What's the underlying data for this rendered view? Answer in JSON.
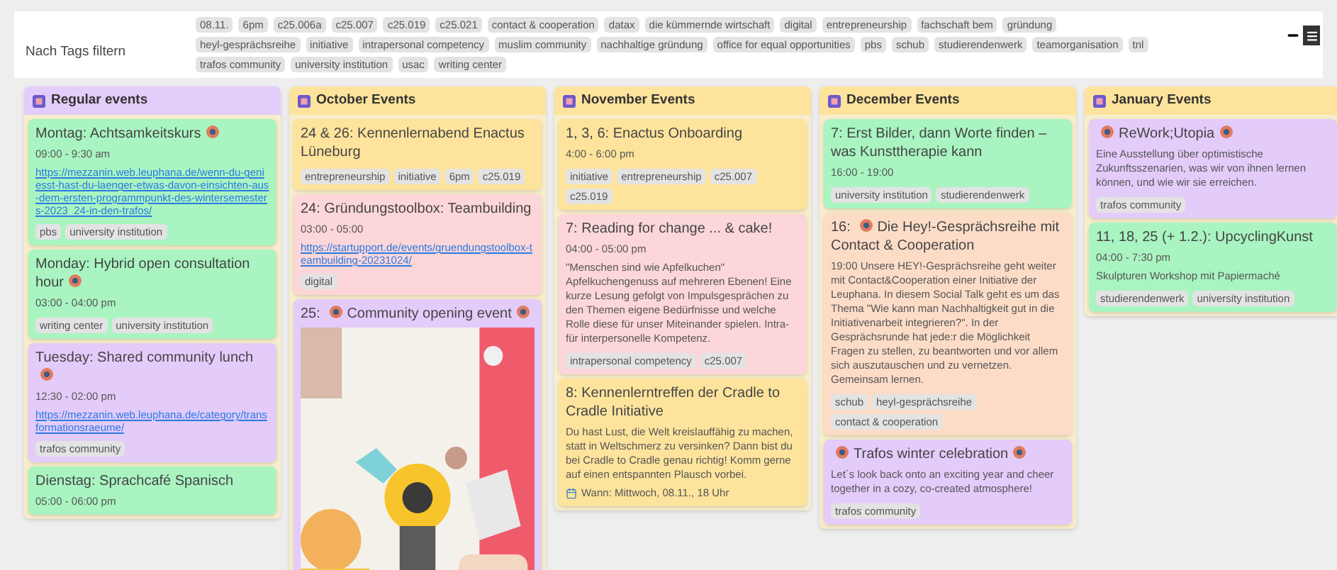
{
  "filter": {
    "label": "Nach Tags filtern",
    "tags": [
      "08.11.",
      "6pm",
      "c25.006a",
      "c25.007",
      "c25.019",
      "c25.021",
      "contact & cooperation",
      "datax",
      "die kümmernde wirtschaft",
      "digital",
      "entrepreneurship",
      "fachschaft bem",
      "gründung",
      "heyl-gesprächsreihe",
      "initiative",
      "intrapersonal competency",
      "muslim community",
      "nachhaltige gründung",
      "office for equal opportunities",
      "pbs",
      "schub",
      "studierendenwerk",
      "teamorganisation",
      "tnl",
      "trafos community",
      "university institution",
      "usac",
      "writing center"
    ]
  },
  "columns": [
    {
      "title": "Regular events",
      "color": "#e3cdfb",
      "cards": [
        {
          "title": "Montag: Achtsamkeitskurs",
          "icon_after": true,
          "color": "#a9f4c1",
          "time": "09:00 - 9:30 am",
          "link": "https://mezzanin.web.leuphana.de/wenn-du-geniesst-hast-du-laenger-etwas-davon-einsichten-aus-dem-ersten-programmpunkt-des-wintersemesters-2023_24-in-den-trafos/",
          "tags": [
            "pbs",
            "university institution"
          ]
        },
        {
          "title": "Monday: Hybrid open consultation hour",
          "icon_after": true,
          "color": "#a9f4c1",
          "time": "03:00 - 04:00 pm",
          "tags": [
            "writing center",
            "university institution"
          ]
        },
        {
          "title": "Tuesday: Shared community lunch",
          "icon_after": true,
          "color": "#e3cbfa",
          "time": "12:30 - 02:00 pm",
          "link": "https://mezzanin.web.leuphana.de/category/transformationsraeume/",
          "tags": [
            "trafos community"
          ]
        },
        {
          "title": "Dienstag: Sprachcafé Spanisch",
          "color": "#a9f4c1",
          "time": "05:00 - 06:00 pm"
        }
      ]
    },
    {
      "title": "October Events",
      "color": "#fde39c",
      "cards": [
        {
          "title": "24 & 26: Kennenlernabend Enactus Lüneburg",
          "color": "#fde39c",
          "tags": [
            "entrepreneurship",
            "initiative",
            "6pm",
            "c25.019"
          ]
        },
        {
          "title": "24: Gründungstoolbox: Teambuilding",
          "color": "#fdd6d9",
          "time": "03:00 - 05:00",
          "link": "https://startupport.de/events/gruendungstoolbox-teambuilding-20231024/",
          "tags": [
            "digital"
          ]
        },
        {
          "prefix": "25:",
          "title": "Community opening event",
          "icon_before": true,
          "icon_after": true,
          "color": "#e3cbfa",
          "picture": true
        }
      ]
    },
    {
      "title": "November Events",
      "color": "#fde39c",
      "cards": [
        {
          "title": "1, 3, 6: Enactus Onboarding",
          "color": "#fde39c",
          "time": "4:00 - 6:00 pm",
          "tags": [
            "initiative",
            "entrepreneurship",
            "c25.007",
            "c25.019"
          ]
        },
        {
          "title": "7: Reading for change ... & cake!",
          "color": "#fdd6d9",
          "time": "04:00 - 05:00 pm",
          "description": "\"Menschen sind wie Apfelkuchen\" Apfelkuchengenuss auf mehreren Ebenen! Eine kurze Lesung gefolgt von Impulsgesprächen zu den Themen eigene Bedürfnisse und welche Rolle diese für unser Miteinander spielen. Intra- für interpersonelle Kompetenz.",
          "tags": [
            "intrapersonal competency",
            "c25.007"
          ]
        },
        {
          "title": "8: Kennenlerntreffen der Cradle to Cradle Initiative",
          "color": "#fde39c",
          "description": "Du hast Lust, die Welt kreislauffähig zu machen, statt in Weltschmerz zu versinken? Dann bist du bei Cradle to Cradle genau richtig! Komm gerne auf einen entspannten Plausch vorbei.",
          "footnote": "Wann: Mittwoch, 08.11., 18 Uhr"
        }
      ]
    },
    {
      "title": "December Events",
      "color": "#fde39c",
      "cards": [
        {
          "title": "7: Erst Bilder, dann Worte finden – was Kunsttherapie kann",
          "color": "#a9f4c1",
          "time": "16:00 - 19:00",
          "tags": [
            "university institution",
            "studierendenwerk"
          ]
        },
        {
          "prefix": "16:",
          "title": "Die Hey!-Gesprächsreihe mit Contact & Cooperation",
          "icon_before": true,
          "color": "#fddcc7",
          "description": "19:00 Unsere HEY!-Gesprächsreihe geht weiter mit Contact&Cooperation einer Initiative der Leuphana. In diesem Social Talk geht es um das Thema \"Wie kann man Nachhaltigkeit gut in die Initiativenarbeit integrieren?\". In der Gesprächsrunde hat jede:r die Möglichkeit Fragen zu stellen, zu beantworten und vor allem sich auszutauschen und zu vernetzen. Gemeinsam lernen.",
          "tags": [
            "schub",
            "heyl-gesprächsreihe",
            "contact & cooperation"
          ]
        },
        {
          "title": "Trafos winter celebration",
          "icon_before": true,
          "icon_after": true,
          "color": "#e3cbfa",
          "description": "Let´s look back onto an exciting year and cheer together in a cozy, co-created atmosphere!",
          "tags": [
            "trafos community"
          ]
        }
      ]
    },
    {
      "title": "January Events",
      "color": "#fde39c",
      "cards": [
        {
          "title": "ReWork;Utopia",
          "icon_before": true,
          "icon_after": true,
          "color": "#e3cbfa",
          "description": "Eine Ausstellung über optimistische Zukunftsszenarien, was wir von ihnen lernen können, und wie wir sie erreichen.",
          "tags": [
            "trafos community"
          ]
        },
        {
          "title": "11, 18, 25 (+ 1.2.): UpcyclingKunst",
          "color": "#a9f4c1",
          "time": "04:00 - 7:30 pm",
          "description": "Skulpturen Workshop mit Papiermaché",
          "tags": [
            "studierendenwerk",
            "university institution"
          ]
        }
      ]
    }
  ]
}
